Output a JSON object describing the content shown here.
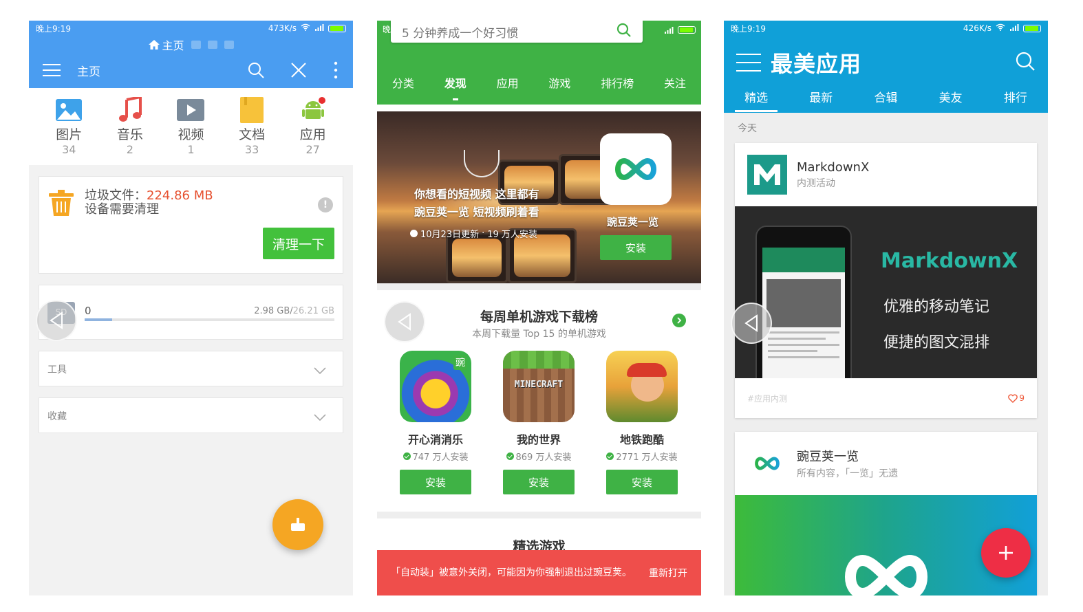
{
  "phone1": {
    "status": {
      "time": "晚上9:19",
      "speed": "473K/s"
    },
    "tab_title": "主页",
    "toolbar_title": "主页",
    "categories": [
      {
        "label": "图片",
        "count": "34",
        "icon": "image-icon"
      },
      {
        "label": "音乐",
        "count": "2",
        "icon": "music-icon"
      },
      {
        "label": "视频",
        "count": "1",
        "icon": "video-icon"
      },
      {
        "label": "文档",
        "count": "33",
        "icon": "document-icon"
      },
      {
        "label": "应用",
        "count": "27",
        "icon": "android-icon"
      }
    ],
    "junk": {
      "label": "垃圾文件：",
      "size": "224.86 MB",
      "hint": "设备需要清理",
      "button": "清理一下"
    },
    "storage": {
      "count": "0",
      "used": "2.98 GB/",
      "total": "26.21 GB",
      "fill_fraction": 0.11
    },
    "tools_label": "工具",
    "favorites_label": "收藏",
    "colors": {
      "primary": "#4a9df1",
      "accent": "#f5a623",
      "clean": "#43c13c",
      "junk_size": "#e6502f"
    }
  },
  "phone2": {
    "status": {
      "time": "晚"
    },
    "search_text": "5 分钟养成一个好习惯",
    "tabs": [
      "分类",
      "发现",
      "应用",
      "游戏",
      "排行榜",
      "关注"
    ],
    "active_tab": 1,
    "banner": {
      "line1": "你想看的短视频 这里都有",
      "line2": "豌豆荚一览 短视频刷着看",
      "updated": "10月23日更新",
      "installs": "19 万人安装",
      "app_name": "豌豆荚一览",
      "install": "安装"
    },
    "rank": {
      "title": "每周单机游戏下载榜",
      "subtitle": "本周下载量 Top 15 的单机游戏"
    },
    "games": [
      {
        "name": "开心消消乐",
        "installs": "747 万人安装",
        "install": "安装",
        "badge": "豌"
      },
      {
        "name": "我的世界",
        "installs": "869 万人安装",
        "install": "安装",
        "logo": "MINECRAFT"
      },
      {
        "name": "地铁跑酷",
        "installs": "2771 万人安装",
        "install": "安装"
      }
    ],
    "featured_title": "精选游戏",
    "toast": {
      "message": "「自动装」被意外关闭，可能因为你强制退出过豌豆荚。",
      "action": "重新打开"
    },
    "colors": {
      "primary": "#3fb245",
      "toast": "#ef4e4b"
    }
  },
  "phone3": {
    "status": {
      "time": "晚上9:19",
      "speed": "426K/s"
    },
    "title": "最美应用",
    "tabs": [
      "精选",
      "最新",
      "合辑",
      "美友",
      "排行"
    ],
    "active_tab": 0,
    "section": "今天",
    "card1": {
      "name": "MarkdownX",
      "desc": "内测活动",
      "brand": "MarkdownX",
      "slogan1": "优雅的移动笔记",
      "slogan2": "便捷的图文混排",
      "tag": "#应用内测",
      "likes": "9"
    },
    "card2": {
      "name": "豌豆荚一览",
      "desc": "所有内容，「一览」无遗"
    },
    "colors": {
      "primary": "#10a0d8",
      "fab": "#ee2e45",
      "brand": "#29b8a4"
    }
  }
}
